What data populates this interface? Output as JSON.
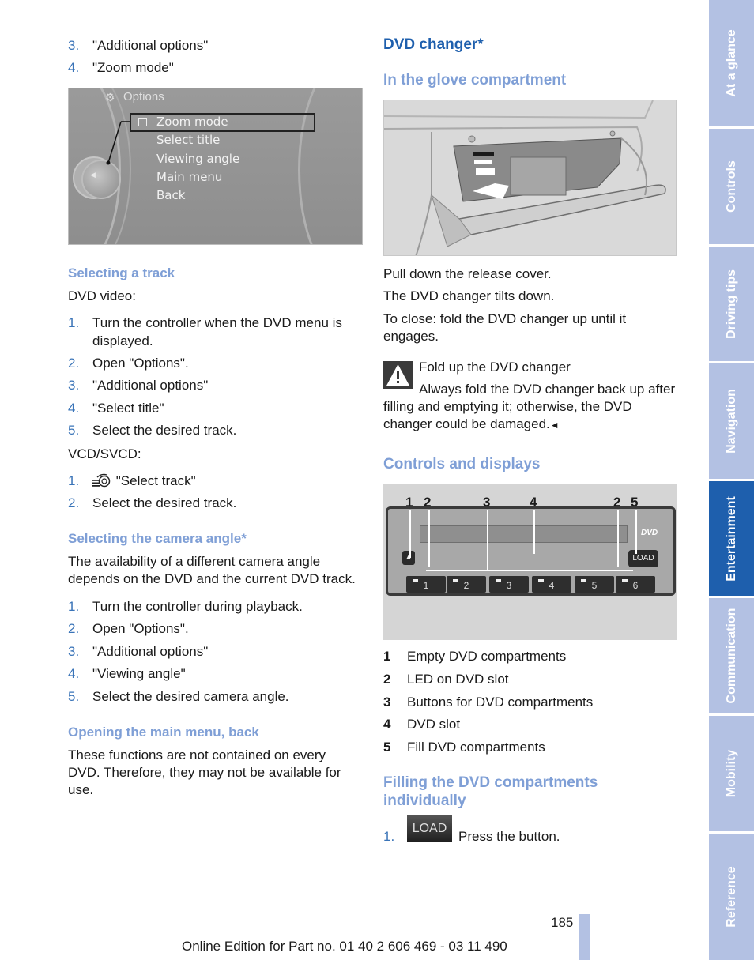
{
  "left_column": {
    "intro_list": [
      {
        "num": "3.",
        "text": "\"Additional options\""
      },
      {
        "num": "4.",
        "text": "\"Zoom mode\""
      }
    ],
    "screen": {
      "title": "Options",
      "items": [
        "Zoom mode",
        "Select title",
        "Viewing angle",
        "Main menu",
        "Back"
      ],
      "selected_item": "Zoom mode"
    },
    "selecting_track": {
      "heading": "Selecting a track",
      "dvd_video_label": "DVD video:",
      "dvd_steps": [
        {
          "num": "1.",
          "text": "Turn the controller when the DVD menu is displayed."
        },
        {
          "num": "2.",
          "text": "Open \"Options\"."
        },
        {
          "num": "3.",
          "text": "\"Additional options\""
        },
        {
          "num": "4.",
          "text": "\"Select title\""
        },
        {
          "num": "5.",
          "text": "Select the desired track."
        }
      ],
      "vcd_label": "VCD/SVCD:",
      "vcd_steps": [
        {
          "num": "1.",
          "icon": "track-select-icon",
          "text": "\"Select track\""
        },
        {
          "num": "2.",
          "text": "Select the desired track."
        }
      ]
    },
    "camera_angle": {
      "heading": "Selecting the camera angle*",
      "text": "The availability of a different camera angle depends on the DVD and the current DVD track.",
      "steps": [
        {
          "num": "1.",
          "text": "Turn the controller during playback."
        },
        {
          "num": "2.",
          "text": "Open \"Options\"."
        },
        {
          "num": "3.",
          "text": "\"Additional options\""
        },
        {
          "num": "4.",
          "text": "\"Viewing angle\""
        },
        {
          "num": "5.",
          "text": "Select the desired camera angle."
        }
      ]
    },
    "main_menu": {
      "heading": "Opening the main menu, back",
      "text": "These functions are not contained on every DVD. Therefore, they may not be available for use."
    }
  },
  "right_column": {
    "heading": "DVD changer*",
    "glove": {
      "heading": "In the glove compartment",
      "lines": [
        "Pull down the release cover.",
        "The DVD changer tilts down.",
        "To close: fold the DVD changer up until it engages."
      ]
    },
    "warning": {
      "title": "Fold up the DVD changer",
      "text": "Always fold the DVD changer back up after filling and emptying it; otherwise, the DVD changer could be damaged.",
      "end_mark": "◄"
    },
    "controls": {
      "heading": "Controls and displays",
      "callouts": [
        "1",
        "2",
        "3",
        "4",
        "2",
        "5"
      ],
      "panel_buttons": [
        "1",
        "2",
        "3",
        "4",
        "5",
        "6"
      ],
      "load_label": "LOAD",
      "dvd_logo": "DVD",
      "legend": [
        {
          "n": "1",
          "t": "Empty DVD compartments"
        },
        {
          "n": "2",
          "t": "LED on DVD slot"
        },
        {
          "n": "3",
          "t": "Buttons for DVD compartments"
        },
        {
          "n": "4",
          "t": "DVD slot"
        },
        {
          "n": "5",
          "t": "Fill DVD compartments"
        }
      ]
    },
    "filling": {
      "heading": "Filling the DVD compartments individually",
      "steps": [
        {
          "num": "1.",
          "button": "LOAD",
          "text": "Press the button."
        }
      ]
    }
  },
  "side_tabs": [
    {
      "label": "At a glance",
      "active": false
    },
    {
      "label": "Controls",
      "active": false
    },
    {
      "label": "Driving tips",
      "active": false
    },
    {
      "label": "Navigation",
      "active": false
    },
    {
      "label": "Entertainment",
      "active": true
    },
    {
      "label": "Communication",
      "active": false
    },
    {
      "label": "Mobility",
      "active": false
    },
    {
      "label": "Reference",
      "active": false
    }
  ],
  "footer": {
    "page_number": "185",
    "edition": "Online Edition for Part no. 01 40 2 606 469 - 03 11 490"
  },
  "colors": {
    "heading_blue": "#1e5fad",
    "subheading_blue": "#7f9fd6",
    "tab_inactive": "#b3c1e3",
    "tab_active": "#1e5fad"
  }
}
